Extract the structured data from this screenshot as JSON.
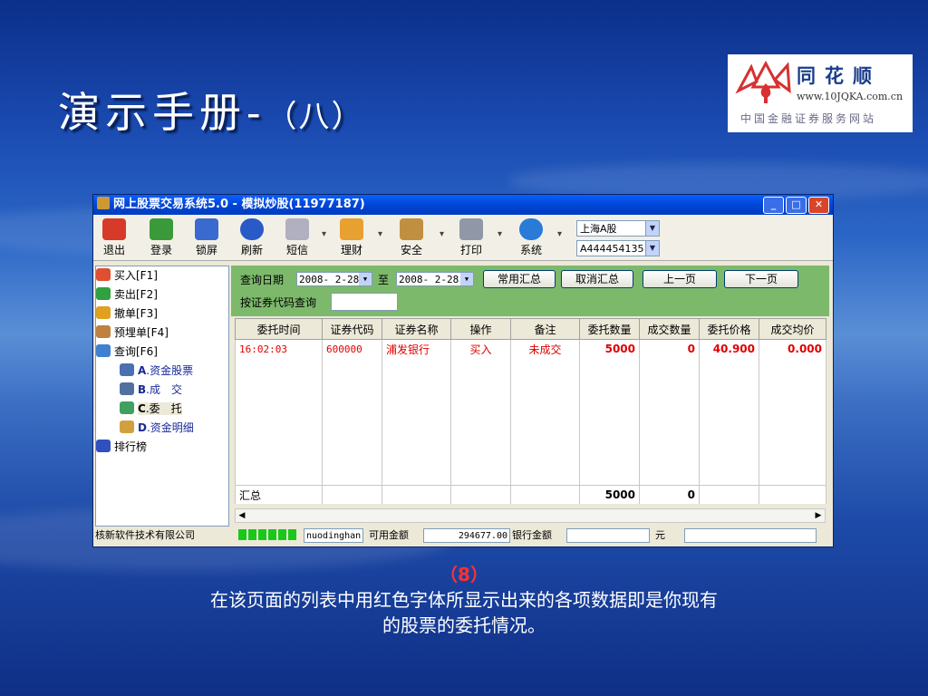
{
  "slide": {
    "title": "演示手册-",
    "title_sub": "（八）",
    "caption_num": "（8）",
    "caption_line1": "在该页面的列表中用红色字体所显示出来的各项数据即是你现有",
    "caption_line2": "的股票的委托情况。"
  },
  "logo": {
    "name": "同花顺",
    "url": "www.10JQKA.com.cn",
    "slogan": "中国金融证券服务网站"
  },
  "window": {
    "title": "网上股票交易系统5.0 - 模拟炒股(11977187)",
    "controls": {
      "minimize": "_",
      "maximize": "□",
      "close": "✕"
    }
  },
  "toolbar": {
    "items": [
      {
        "label": "退出",
        "icon": "exit-icon",
        "color": "#d83a2a"
      },
      {
        "label": "登录",
        "icon": "login-icon",
        "color": "#3a9a3a"
      },
      {
        "label": "锁屏",
        "icon": "lock-screen-icon",
        "color": "#3a6ad0"
      },
      {
        "label": "刷新",
        "icon": "refresh-icon",
        "color": "#2a5ac8"
      },
      {
        "label": "短信",
        "icon": "message-icon",
        "color": "#b0b0c0"
      },
      {
        "label": "理财",
        "icon": "finance-icon",
        "color": "#e8a030"
      },
      {
        "label": "安全",
        "icon": "security-icon",
        "color": "#c09040"
      },
      {
        "label": "打印",
        "icon": "print-icon",
        "color": "#9098a8"
      },
      {
        "label": "系统",
        "icon": "system-info-icon",
        "color": "#2a7ad8"
      }
    ],
    "market_select": "上海A股",
    "account_select": "A444454135"
  },
  "sidebar": {
    "items": [
      {
        "label": "买入[F1]",
        "color": "#e05030"
      },
      {
        "label": "卖出[F2]",
        "color": "#30a040"
      },
      {
        "label": "撤单[F3]",
        "color": "#e0a020"
      },
      {
        "label": "预埋单[F4]",
        "color": "#c08040"
      },
      {
        "label": "查询[F6]",
        "color": "#4080d0"
      }
    ],
    "subitems": [
      {
        "key": "A",
        "label": ".资金股票",
        "color": "#4a70b0"
      },
      {
        "key": "B",
        "label": ".成　交",
        "color": "#5070a0"
      },
      {
        "key": "C",
        "label": ".委　托",
        "color": "#40a060"
      },
      {
        "key": "D",
        "label": ".资金明细",
        "color": "#d0a040"
      }
    ],
    "ranking": {
      "label": "排行榜",
      "color": "#3050c0"
    }
  },
  "query": {
    "date_label": "查询日期",
    "start_date": "2008- 2-28",
    "to_label": "至",
    "end_date": "2008- 2-28",
    "code_label": "按证券代码查询",
    "buttons": {
      "summary": "常用汇总",
      "cancel_summary": "取消汇总",
      "prev_page": "上一页",
      "next_page": "下一页"
    }
  },
  "table": {
    "columns": [
      "委托时间",
      "证券代码",
      "证券名称",
      "操作",
      "备注",
      "委托数量",
      "成交数量",
      "委托价格",
      "成交均价"
    ],
    "rows": [
      {
        "time": "16:02:03",
        "code": "600000",
        "name": "浦发银行",
        "action": "买入",
        "remark": "未成交",
        "qty": "5000",
        "filled": "0",
        "price": "40.900",
        "avg": "0.000"
      }
    ],
    "total": {
      "label": "汇总",
      "qty": "5000",
      "filled": "0"
    }
  },
  "statusbar": {
    "company": "核新软件技术有限公司",
    "user": "nuodinghan",
    "available_label": "可用金额",
    "available_value": "294677.00",
    "bank_label": "银行金额",
    "unit": "元"
  }
}
